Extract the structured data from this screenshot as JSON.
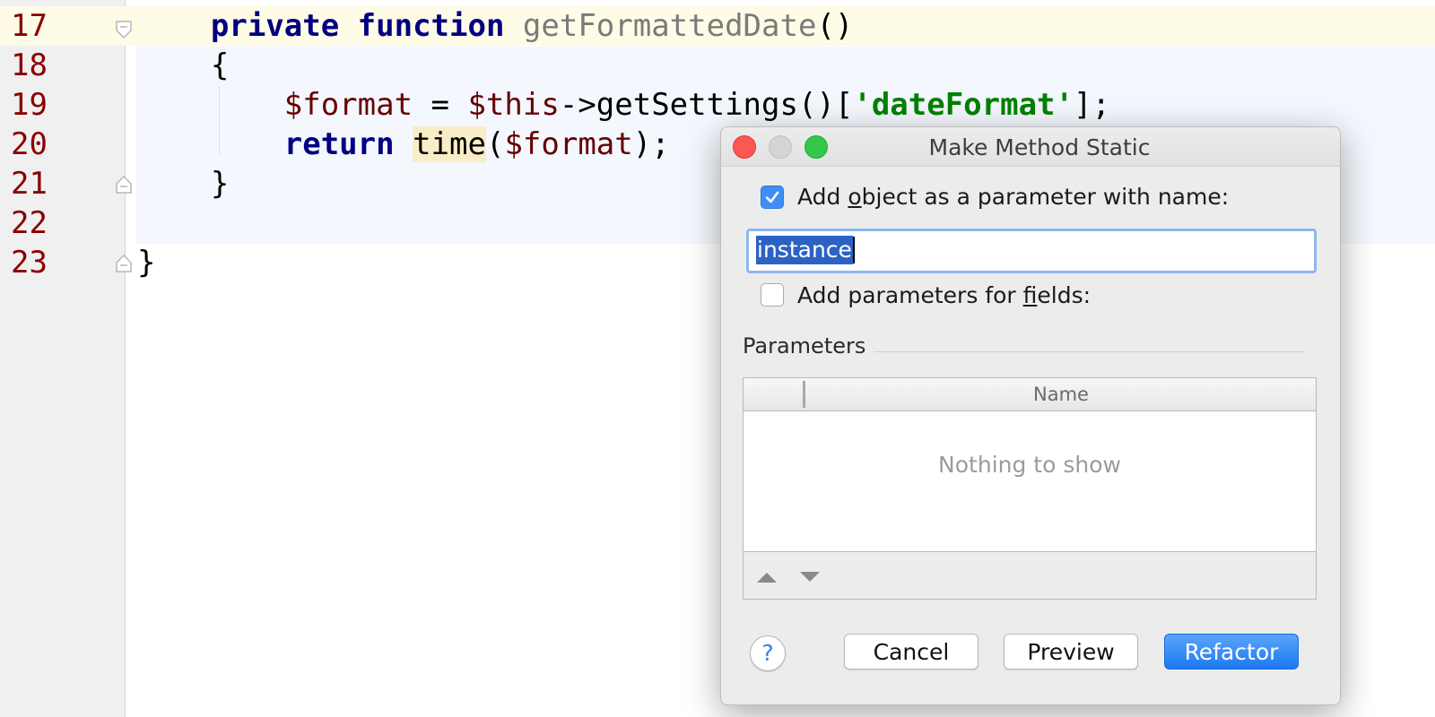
{
  "editor": {
    "lines": [
      {
        "num": "17"
      },
      {
        "num": "18"
      },
      {
        "num": "19"
      },
      {
        "num": "20"
      },
      {
        "num": "21"
      },
      {
        "num": "22"
      },
      {
        "num": "23"
      }
    ],
    "tokens": {
      "private": "private",
      "function": "function",
      "fn_name": "getFormattedDate",
      "parens": "()",
      "brace_open": "{",
      "brace_close": "}",
      "var_format": "$format",
      "assign": " = ",
      "var_this": "$this",
      "arrow_call": "->getSettings()[",
      "str_dateformat": "'dateFormat'",
      "bracket_end": "];",
      "return": "return",
      "time": "time",
      "paren_open": "(",
      "paren_close_semi": ");"
    }
  },
  "dialog": {
    "title": "Make Method Static",
    "add_object_label_pre": "Add ",
    "add_object_label_mn": "o",
    "add_object_label_post": "bject as a parameter with name:",
    "add_object_checked": true,
    "param_name_value": "instance",
    "add_fields_label_pre": "Add parameters for ",
    "add_fields_label_mn": "f",
    "add_fields_label_post": "ields:",
    "add_fields_checked": false,
    "parameters_section": "Parameters",
    "table_col_name": "Name",
    "empty_text": "Nothing to show",
    "help_label": "?",
    "cancel_label": "Cancel",
    "preview_label": "Preview",
    "refactor_label": "Refactor",
    "colors": {
      "accent": "#1e78f0",
      "checkbox": "#3e8ef7",
      "close": "#fc5753",
      "maximize": "#34c84a"
    },
    "icons": [
      "move-up-icon",
      "move-down-icon",
      "checkmark-icon"
    ]
  }
}
